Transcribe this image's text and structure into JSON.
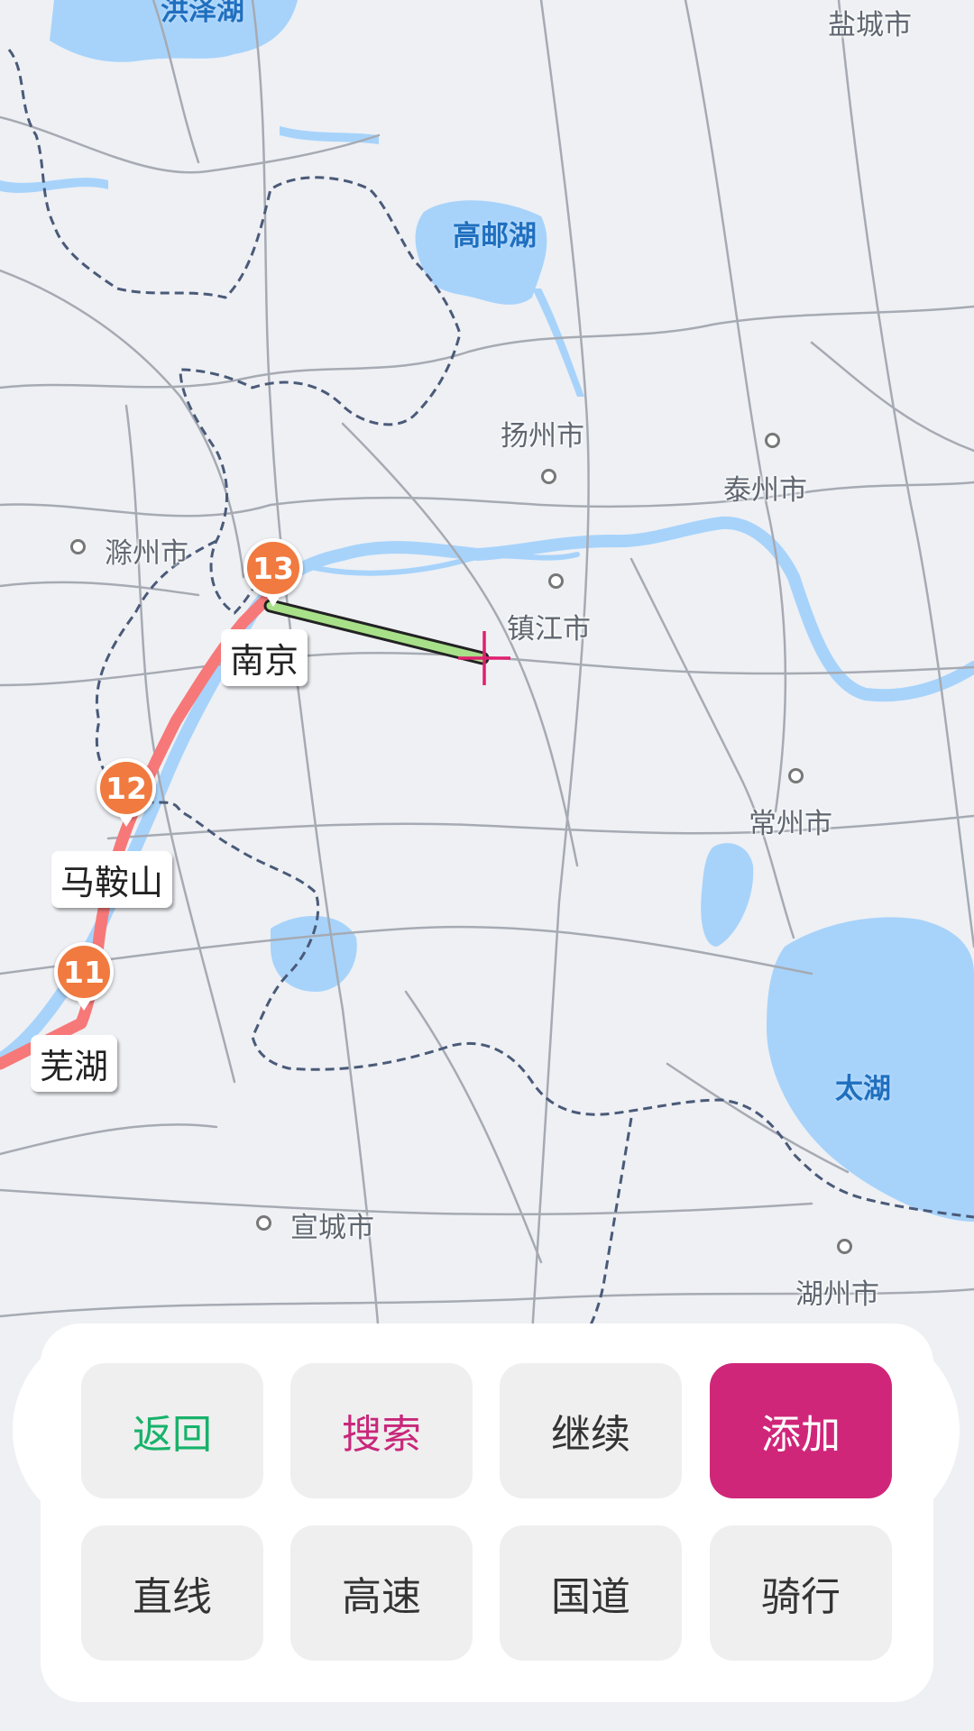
{
  "map": {
    "cities": [
      {
        "name": "盐城市"
      },
      {
        "name": "扬州市"
      },
      {
        "name": "泰州市"
      },
      {
        "name": "滁州市"
      },
      {
        "name": "镇江市"
      },
      {
        "name": "常州市"
      },
      {
        "name": "宣城市"
      },
      {
        "name": "湖州市"
      }
    ],
    "lakes": [
      {
        "name": "洪泽湖"
      },
      {
        "name": "高邮湖"
      },
      {
        "name": "太湖"
      }
    ],
    "route_stops": [
      {
        "number": "13",
        "label": "南京"
      },
      {
        "number": "12",
        "label": "马鞍山"
      },
      {
        "number": "11",
        "label": "芜湖"
      }
    ],
    "colors": {
      "water": "#a7d3fb",
      "route": "#f77878",
      "new_segment": "#a8e08a",
      "crosshair": "#e0206e",
      "pin": "#f07a3f",
      "boundary": "#4a5a78"
    }
  },
  "toolbar": {
    "row1": [
      {
        "label": "返回"
      },
      {
        "label": "搜索"
      },
      {
        "label": "继续"
      },
      {
        "label": "添加"
      }
    ],
    "row2": [
      {
        "label": "直线"
      },
      {
        "label": "高速"
      },
      {
        "label": "国道"
      },
      {
        "label": "骑行"
      }
    ]
  }
}
